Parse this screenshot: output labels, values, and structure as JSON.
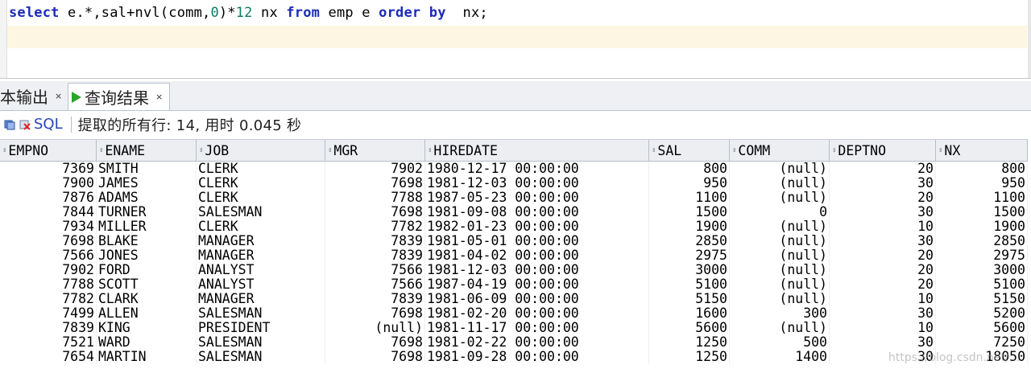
{
  "editor": {
    "sql_parts": [
      {
        "t": "select",
        "k": "kw"
      },
      {
        "t": " e.*,sal+nvl(comm,",
        "k": ""
      },
      {
        "t": "0",
        "k": "num"
      },
      {
        "t": ")*",
        "k": ""
      },
      {
        "t": "12",
        "k": "num"
      },
      {
        "t": " nx ",
        "k": ""
      },
      {
        "t": "from",
        "k": "kw"
      },
      {
        "t": " emp e ",
        "k": ""
      },
      {
        "t": "order by",
        "k": "kw"
      },
      {
        "t": "  nx;",
        "k": ""
      }
    ]
  },
  "tabs": [
    {
      "label": "本输出",
      "close": "×",
      "active": false
    },
    {
      "label": "查询结果",
      "close": "×",
      "active": true,
      "icon": "play-icon"
    }
  ],
  "toolbar": {
    "sql_label": "SQL",
    "status": "提取的所有行: 14, 用时 0.045 秒"
  },
  "columns": [
    "EMPNO",
    "ENAME",
    "JOB",
    "MGR",
    "HIREDATE",
    "SAL",
    "COMM",
    "DEPTNO",
    "NX"
  ],
  "rows": [
    [
      "7369",
      "SMITH",
      "CLERK",
      "7902",
      "1980-12-17 00:00:00",
      "800",
      "(null)",
      "20",
      "800"
    ],
    [
      "7900",
      "JAMES",
      "CLERK",
      "7698",
      "1981-12-03 00:00:00",
      "950",
      "(null)",
      "30",
      "950"
    ],
    [
      "7876",
      "ADAMS",
      "CLERK",
      "7788",
      "1987-05-23 00:00:00",
      "1100",
      "(null)",
      "20",
      "1100"
    ],
    [
      "7844",
      "TURNER",
      "SALESMAN",
      "7698",
      "1981-09-08 00:00:00",
      "1500",
      "0",
      "30",
      "1500"
    ],
    [
      "7934",
      "MILLER",
      "CLERK",
      "7782",
      "1982-01-23 00:00:00",
      "1900",
      "(null)",
      "10",
      "1900"
    ],
    [
      "7698",
      "BLAKE",
      "MANAGER",
      "7839",
      "1981-05-01 00:00:00",
      "2850",
      "(null)",
      "30",
      "2850"
    ],
    [
      "7566",
      "JONES",
      "MANAGER",
      "7839",
      "1981-04-02 00:00:00",
      "2975",
      "(null)",
      "20",
      "2975"
    ],
    [
      "7902",
      "FORD",
      "ANALYST",
      "7566",
      "1981-12-03 00:00:00",
      "3000",
      "(null)",
      "20",
      "3000"
    ],
    [
      "7788",
      "SCOTT",
      "ANALYST",
      "7566",
      "1987-04-19 00:00:00",
      "5100",
      "(null)",
      "20",
      "5100"
    ],
    [
      "7782",
      "CLARK",
      "MANAGER",
      "7839",
      "1981-06-09 00:00:00",
      "5150",
      "(null)",
      "10",
      "5150"
    ],
    [
      "7499",
      "ALLEN",
      "SALESMAN",
      "7698",
      "1981-02-20 00:00:00",
      "1600",
      "300",
      "30",
      "5200"
    ],
    [
      "7839",
      "KING",
      "PRESIDENT",
      "(null)",
      "1981-11-17 00:00:00",
      "5600",
      "(null)",
      "10",
      "5600"
    ],
    [
      "7521",
      "WARD",
      "SALESMAN",
      "7698",
      "1981-02-22 00:00:00",
      "1250",
      "500",
      "30",
      "7250"
    ],
    [
      "7654",
      "MARTIN",
      "SALESMAN",
      "7698",
      "1981-09-28 00:00:00",
      "1250",
      "1400",
      "30",
      "18050"
    ]
  ],
  "watermark": "https://blog.csdn.net/..."
}
